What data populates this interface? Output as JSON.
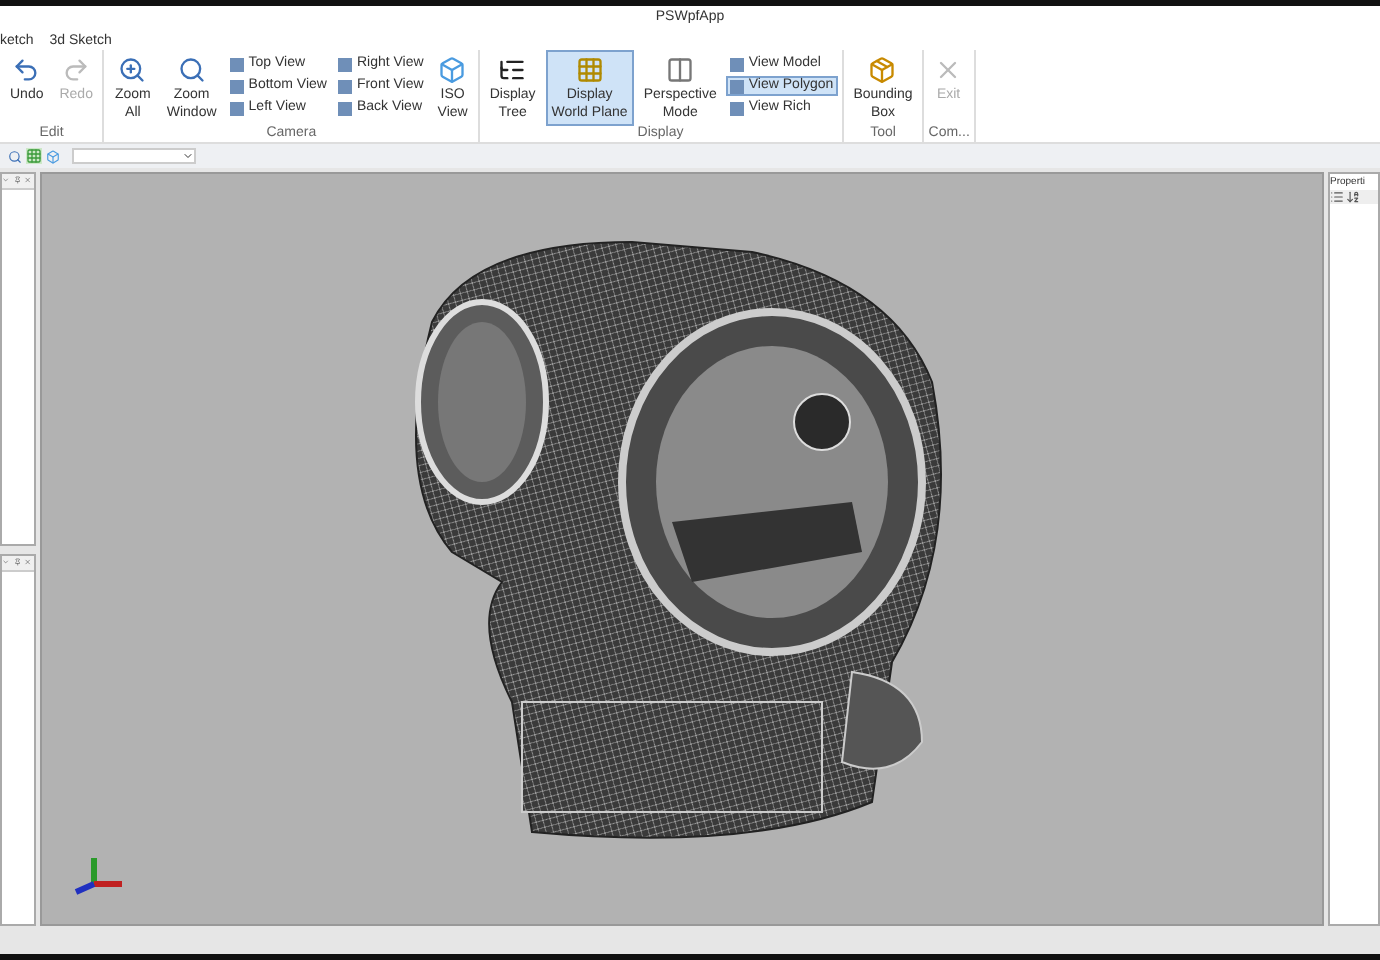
{
  "window": {
    "title": "PSWpfApp"
  },
  "tabs": [
    {
      "label": "ketch"
    },
    {
      "label": "3d Sketch"
    }
  ],
  "ribbon": {
    "groups": [
      {
        "label": "Edit",
        "items": [
          {
            "kind": "large",
            "lines": [
              "Undo"
            ],
            "disabled": false,
            "selected": false
          },
          {
            "kind": "large",
            "lines": [
              "Redo"
            ],
            "disabled": true,
            "selected": false
          }
        ]
      },
      {
        "label": "Camera",
        "items": [
          {
            "kind": "large",
            "lines": [
              "Zoom",
              "All"
            ],
            "disabled": false,
            "selected": false
          },
          {
            "kind": "large",
            "lines": [
              "Zoom",
              "Window"
            ],
            "disabled": false,
            "selected": false
          },
          {
            "kind": "stack",
            "items": [
              {
                "label": "Top View",
                "selected": false
              },
              {
                "label": "Bottom View",
                "selected": false
              },
              {
                "label": "Left View",
                "selected": false
              }
            ]
          },
          {
            "kind": "stack",
            "items": [
              {
                "label": "Right View",
                "selected": false
              },
              {
                "label": "Front View",
                "selected": false
              },
              {
                "label": "Back View",
                "selected": false
              }
            ]
          },
          {
            "kind": "large",
            "lines": [
              "ISO",
              "View"
            ],
            "disabled": false,
            "selected": false
          }
        ]
      },
      {
        "label": "Display",
        "items": [
          {
            "kind": "large",
            "lines": [
              "Display",
              "Tree"
            ],
            "disabled": false,
            "selected": false
          },
          {
            "kind": "large",
            "lines": [
              "Display",
              "World Plane"
            ],
            "disabled": false,
            "selected": true
          },
          {
            "kind": "large",
            "lines": [
              "Perspective",
              "Mode"
            ],
            "disabled": false,
            "selected": false
          },
          {
            "kind": "stack",
            "items": [
              {
                "label": "View Model",
                "selected": false
              },
              {
                "label": "View Polygon",
                "selected": true
              },
              {
                "label": "View Rich",
                "selected": false
              }
            ]
          }
        ]
      },
      {
        "label": "Tool",
        "items": [
          {
            "kind": "large",
            "lines": [
              "Bounding",
              "Box"
            ],
            "disabled": false,
            "selected": false
          }
        ]
      },
      {
        "label": "Com...",
        "items": [
          {
            "kind": "large",
            "lines": [
              "Exit"
            ],
            "disabled": true,
            "selected": false
          }
        ]
      }
    ]
  },
  "properties_panel": {
    "title": "Properti"
  }
}
